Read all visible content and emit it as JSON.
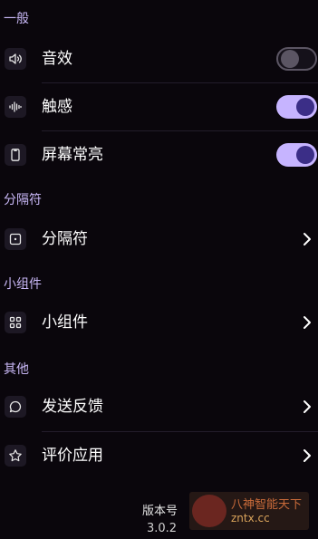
{
  "sections": {
    "general": {
      "title": "一般"
    },
    "separator": {
      "title": "分隔符"
    },
    "widgets": {
      "title": "小组件"
    },
    "other": {
      "title": "其他"
    }
  },
  "rows": {
    "sound": {
      "label": "音效",
      "toggle": false
    },
    "haptics": {
      "label": "触感",
      "toggle": true
    },
    "screen_on": {
      "label": "屏幕常亮",
      "toggle": true
    },
    "separator": {
      "label": "分隔符"
    },
    "widget": {
      "label": "小组件"
    },
    "feedback": {
      "label": "发送反馈"
    },
    "rate": {
      "label": "评价应用"
    }
  },
  "footer": {
    "version_label": "版本号",
    "version": "3.0.2"
  },
  "watermark": {
    "line1": "八神智能天下",
    "line2": "zntx.cc"
  },
  "colors": {
    "accent": "#c6b4ff",
    "background": "#0a060c",
    "section_title": "#c9b8f7"
  },
  "icons": {
    "sound": "speaker-icon",
    "haptics": "waveform-icon",
    "screen_on": "phone-icon",
    "separator": "dot-square-icon",
    "widget": "grid-icon",
    "feedback": "chat-bubble-icon",
    "rate": "star-icon"
  }
}
